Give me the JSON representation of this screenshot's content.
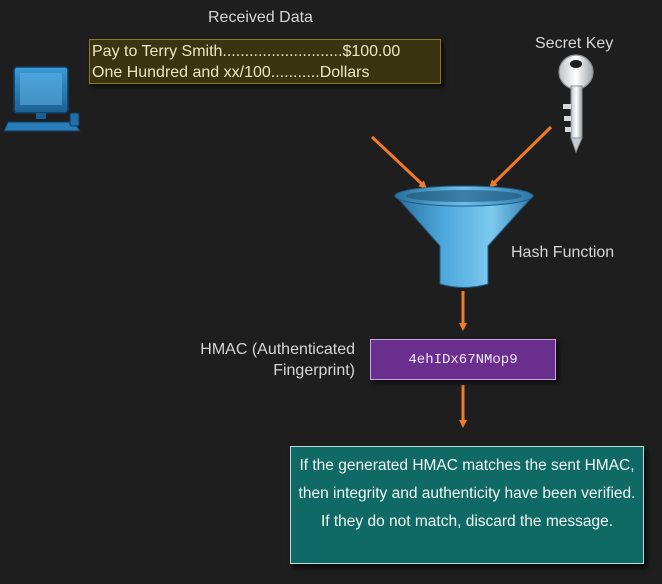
{
  "received": {
    "title": "Received Data",
    "line1": "Pay to Terry Smith...........................$100.00",
    "line2": "One Hundred and xx/100...........Dollars"
  },
  "secret_key": {
    "label": "Secret Key"
  },
  "hash_function": {
    "label": "Hash Function"
  },
  "hmac": {
    "label_line1": "HMAC (Authenticated",
    "label_line2": "Fingerprint)",
    "value": "4ehIDx67NMop9"
  },
  "note": {
    "text": "If the generated HMAC matches the sent HMAC, then integrity and authenticity have been verified. If they do not match, discard the message."
  },
  "colors": {
    "background": "#1e1e1e",
    "data_box": "#3a3510",
    "hmac_box": "#6a2e8e",
    "note_box": "#0f6a66",
    "arrow": "#f07a28",
    "funnel": "#3a8fc4",
    "computer": "#2f86c4"
  },
  "icons": [
    "computer-icon",
    "key-icon",
    "funnel-icon"
  ]
}
